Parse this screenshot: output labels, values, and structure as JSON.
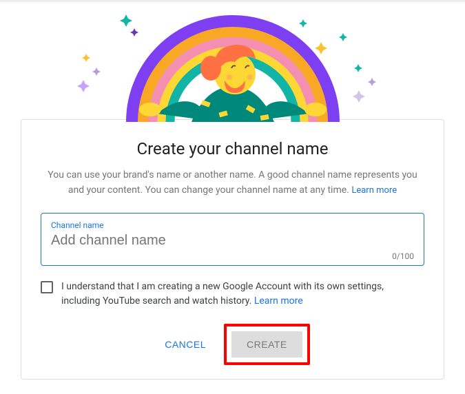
{
  "title": "Create your channel name",
  "subtitle_part1": "You can use your brand's name or another name. A good channel name represents you and your content. You can change your channel name at any time. ",
  "subtitle_learn_more": "Learn more",
  "input": {
    "label": "Channel name",
    "placeholder": "Add channel name",
    "counter": "0/100"
  },
  "consent": {
    "text_part1": "I understand that I am creating a new Google Account with its own settings, including YouTube search and watch history. ",
    "learn_more": "Learn more"
  },
  "actions": {
    "cancel": "CANCEL",
    "create": "CREATE"
  }
}
